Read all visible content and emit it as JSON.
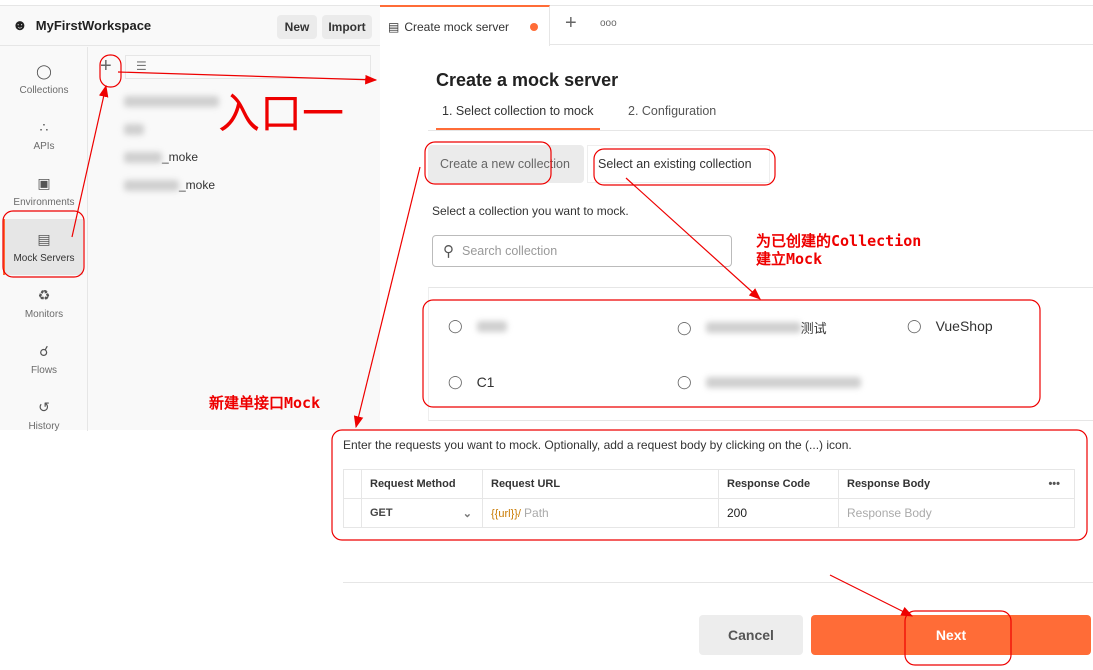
{
  "workspace": {
    "name": "MyFirstWorkspace",
    "new_label": "New",
    "import_label": "Import"
  },
  "nav": [
    {
      "label": "Collections",
      "icon": "collections-icon"
    },
    {
      "label": "APIs",
      "icon": "apis-icon"
    },
    {
      "label": "Environments",
      "icon": "environments-icon"
    },
    {
      "label": "Mock Servers",
      "icon": "mock-servers-icon",
      "active": true
    },
    {
      "label": "Monitors",
      "icon": "monitors-icon"
    },
    {
      "label": "Flows",
      "icon": "flows-icon"
    },
    {
      "label": "History",
      "icon": "history-icon"
    }
  ],
  "mock_list": [
    "_moke",
    "_moke"
  ],
  "tab": {
    "label": "Create mock server",
    "new_tab": "+",
    "more": "ooo"
  },
  "page": {
    "title": "Create a mock server",
    "steps": [
      "1. Select collection to mock",
      "2. Configuration"
    ],
    "create_new": "Create a new collection",
    "select_existing": "Select an existing collection",
    "instruction": "Select a collection you want to mock.",
    "search_placeholder": "Search collection",
    "collections": [
      "",
      "测试",
      "VueShop",
      "C1",
      ""
    ],
    "requests_hint": "Enter the requests you want to mock. Optionally, add a request body by clicking on the (...) icon.",
    "table": {
      "headers": [
        "Request Method",
        "Request URL",
        "Response Code",
        "Response Body"
      ],
      "more": "•••",
      "row": {
        "method": "GET",
        "url_prefix": "{{url}}/",
        "url_placeholder": "Path",
        "code": "200",
        "body_placeholder": "Response Body"
      }
    },
    "cancel": "Cancel",
    "next": "Next"
  },
  "annotations": {
    "entry": "入口一",
    "existing": "为已创建的Collection",
    "existing2": "建立Mock",
    "new_single": "新建单接口Mock"
  },
  "colors": {
    "accent": "#ff6c37",
    "annotation": "#e00000"
  }
}
